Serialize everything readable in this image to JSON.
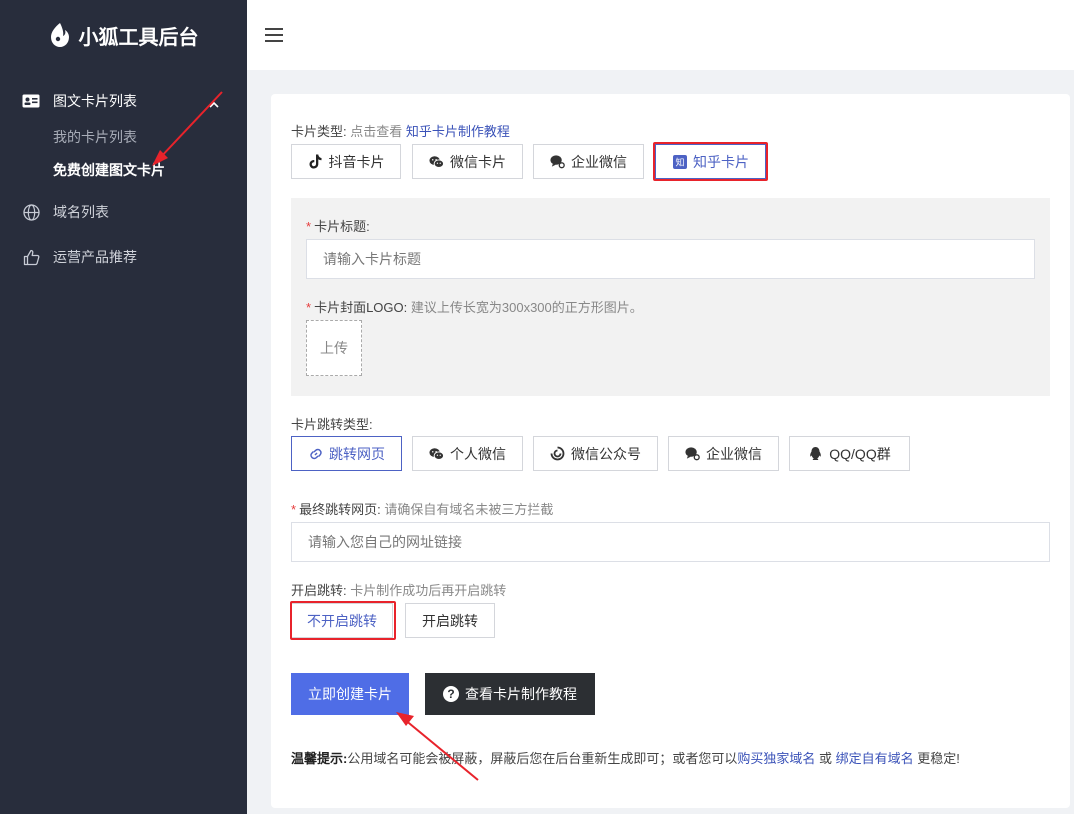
{
  "brand": {
    "title": "小狐工具后台"
  },
  "sidebar": {
    "items": [
      {
        "label": "图文卡片列表",
        "icon": "id-card-icon"
      },
      {
        "label": "域名列表",
        "icon": "globe-icon"
      },
      {
        "label": "运营产品推荐",
        "icon": "thumbs-up-icon"
      }
    ],
    "submenu": [
      {
        "label": "我的卡片列表"
      },
      {
        "label": "免费创建图文卡片"
      }
    ]
  },
  "form": {
    "card_type": {
      "label": "卡片类型:",
      "hint": "点击查看",
      "link": "知乎卡片制作教程",
      "options": [
        {
          "label": "抖音卡片",
          "icon": "tiktok-icon"
        },
        {
          "label": "微信卡片",
          "icon": "wechat-icon"
        },
        {
          "label": "企业微信",
          "icon": "wework-icon"
        },
        {
          "label": "知乎卡片",
          "icon": "zhihu-icon"
        }
      ]
    },
    "title_field": {
      "required": "*",
      "label": "卡片标题:",
      "placeholder": "请输入卡片标题"
    },
    "logo_field": {
      "required": "*",
      "label": "卡片封面LOGO:",
      "hint": "建议上传长宽为300x300的正方形图片。",
      "upload_label": "上传"
    },
    "jump_type": {
      "label": "卡片跳转类型:",
      "options": [
        {
          "label": "跳转网页",
          "icon": "link-icon"
        },
        {
          "label": "个人微信",
          "icon": "wechat-icon"
        },
        {
          "label": "微信公众号",
          "icon": "official-account-icon"
        },
        {
          "label": "企业微信",
          "icon": "wework-icon"
        },
        {
          "label": "QQ/QQ群",
          "icon": "qq-icon"
        }
      ]
    },
    "final_url": {
      "required": "*",
      "label": "最终跳转网页:",
      "hint": "请确保自有域名未被三方拦截",
      "placeholder": "请输入您自己的网址链接"
    },
    "enable_jump": {
      "label": "开启跳转:",
      "hint": "卡片制作成功后再开启跳转",
      "options": [
        {
          "label": "不开启跳转"
        },
        {
          "label": "开启跳转"
        }
      ]
    },
    "submit_label": "立即创建卡片",
    "tutorial_label": "查看卡片制作教程",
    "tip": {
      "prefix": "温馨提示:",
      "text1": "公用域名可能会被屏蔽，屏蔽后您在后台重新生成即可；或者您可以",
      "link1": "购买独家域名",
      "mid": " 或 ",
      "link2": "绑定自有域名",
      "suffix": " 更稳定!"
    }
  },
  "colors": {
    "sidebar_bg": "#282d3c",
    "primary": "#4f6de6",
    "selected": "#4d62c4",
    "annotation": "#e8232b"
  }
}
